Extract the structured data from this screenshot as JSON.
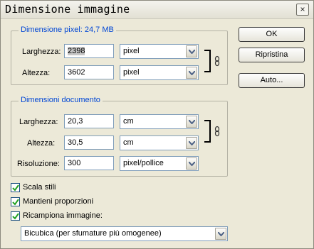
{
  "window": {
    "title": "Dimensione immagine",
    "close_glyph": "×"
  },
  "pixel_dimensions": {
    "legend": "Dimensione pixel:",
    "size": "24,7 MB",
    "width_label": "Larghezza:",
    "width_value": "2398",
    "width_unit": "pixel",
    "height_label": "Altezza:",
    "height_value": "3602",
    "height_unit": "pixel"
  },
  "document_size": {
    "legend": "Dimensioni documento",
    "width_label": "Larghezza:",
    "width_value": "20,3",
    "width_unit": "cm",
    "height_label": "Altezza:",
    "height_value": "30,5",
    "height_unit": "cm",
    "resolution_label": "Risoluzione:",
    "resolution_value": "300",
    "resolution_unit": "pixel/pollice"
  },
  "options": {
    "scale_styles": {
      "label": "Scala stili",
      "checked": true
    },
    "constrain_proportions": {
      "label": "Mantieni proporzioni",
      "checked": true
    },
    "resample": {
      "label": "Ricampiona immagine:",
      "checked": true
    },
    "resample_method": "Bicubica (per sfumature più omogenee)"
  },
  "buttons": {
    "ok": "OK",
    "reset": "Ripristina",
    "auto": "Auto..."
  },
  "icons": {
    "link": "chain-link-icon",
    "dropdown": "chevron-down-icon",
    "check": "checkmark-icon"
  },
  "colors": {
    "legend_text": "#0046d5",
    "dialog_bg": "#ece9d8",
    "check": "#21a121"
  }
}
